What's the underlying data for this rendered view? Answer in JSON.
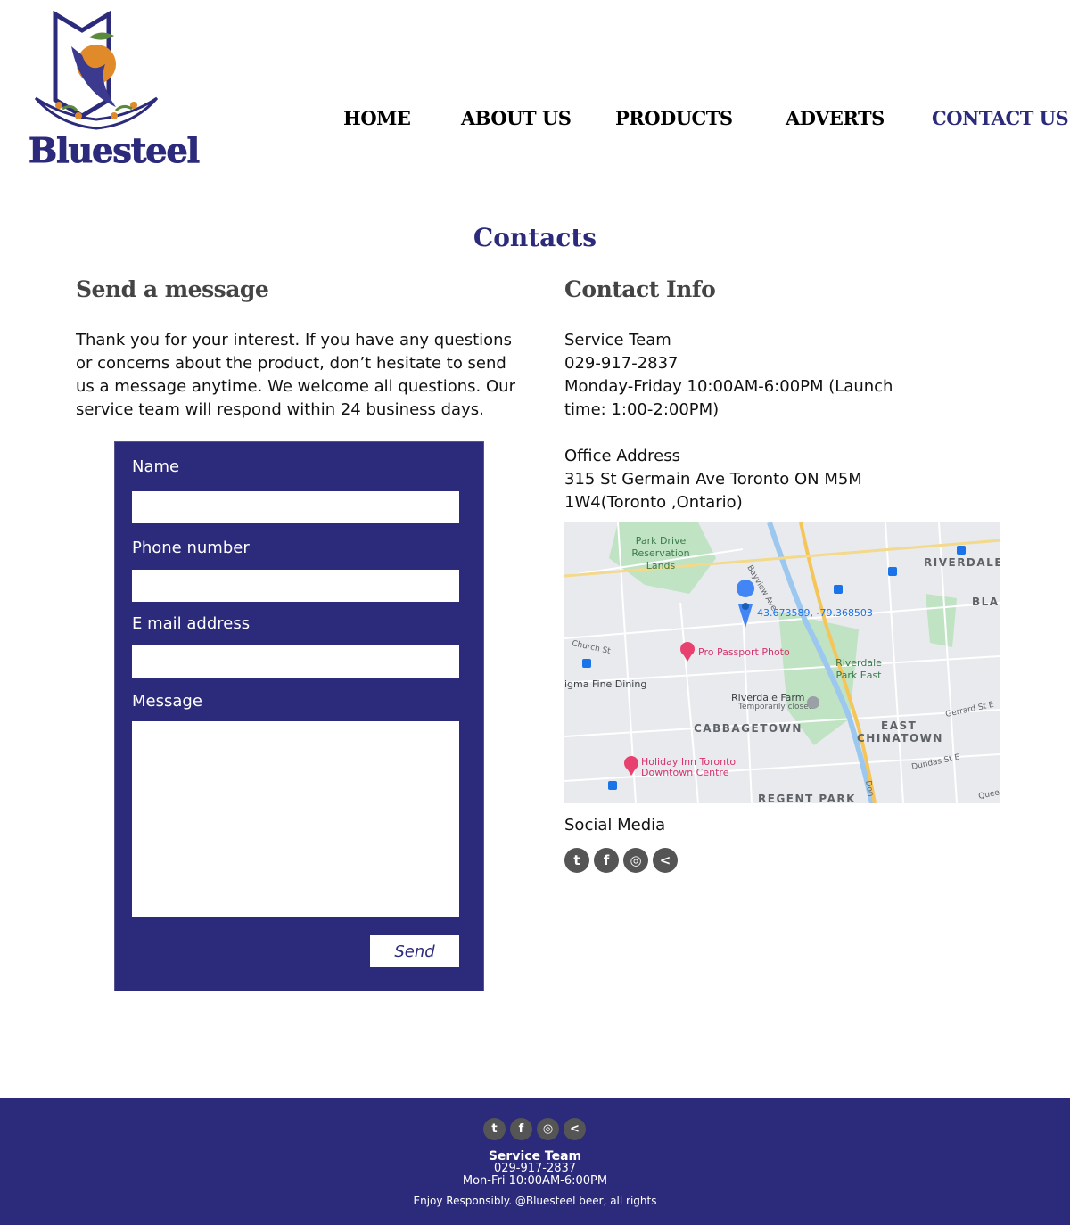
{
  "brand": {
    "name": "Bluesteel"
  },
  "nav": {
    "items": [
      {
        "label": "HOME"
      },
      {
        "label": "ABOUT US"
      },
      {
        "label": "PRODUCTS"
      },
      {
        "label": "ADVERTS"
      },
      {
        "label": "CONTACT US",
        "active": true
      }
    ]
  },
  "page": {
    "title": "Contacts"
  },
  "message_section": {
    "title": "Send a message",
    "intro": "Thank you for your interest. If you have any questions or concerns about the product, don’t hesitate to send us a message anytime. We welcome all questions. Our service team will respond within 24 business days.",
    "form": {
      "name_label": "Name",
      "phone_label": "Phone number",
      "email_label": "E mail address",
      "message_label": "Message",
      "name_value": "",
      "phone_value": "",
      "email_value": "",
      "message_value": "",
      "send_label": "Send"
    }
  },
  "contact_info": {
    "title": "Contact Info",
    "service_team": "Service Team",
    "phone": "029-917-2837",
    "hours": "Monday-Friday 10:00AM-6:00PM (Launch time: 1:00-2:00PM)",
    "office_label": "Office Address",
    "office_address": "315 St Germain Ave Toronto ON M5M 1W4(Toronto ,Ontario)",
    "map": {
      "labels": {
        "park_drive_1": "Park Drive",
        "park_drive_2": "Reservation",
        "park_drive_3": "Lands",
        "riverdale": "RIVERDALE",
        "bla": "BLA",
        "bayview": "Bayview Ave",
        "coords": "43.673589, -79.368503",
        "passport": "Pro Passport Photo",
        "church": "Church St",
        "riverdale_park_east_1": "Riverdale",
        "riverdale_park_east_2": "Park East",
        "sigma": "igma Fine Dining",
        "farm": "Riverdale Farm",
        "farm_status": "Temporarily closed",
        "cabbagetown": "CABBAGETOWN",
        "east": "EAST",
        "chinatown": "CHINATOWN",
        "gerrard": "Gerrard St E",
        "holiday_1": "Holiday Inn Toronto",
        "holiday_2": "Downtown Centre",
        "dundas": "Dundas St E",
        "regent_park": "REGENT PARK",
        "don": "Don",
        "queen": "Queen"
      }
    },
    "social_label": "Social Media"
  },
  "social_icons": [
    {
      "name": "twitter-icon",
      "glyph": "t"
    },
    {
      "name": "facebook-icon",
      "glyph": "f"
    },
    {
      "name": "instagram-icon",
      "glyph": "◎"
    },
    {
      "name": "share-icon",
      "glyph": "<"
    }
  ],
  "footer": {
    "service_team": "Service Team",
    "phone": "029-917-2837",
    "hours": "Mon-Fri 10:00AM-6:00PM",
    "copyright": "Enjoy Responsibly. @Bluesteel beer, all rights"
  },
  "colors": {
    "brand": "#2c2a7a",
    "footer_bg": "#2c2a7a"
  }
}
